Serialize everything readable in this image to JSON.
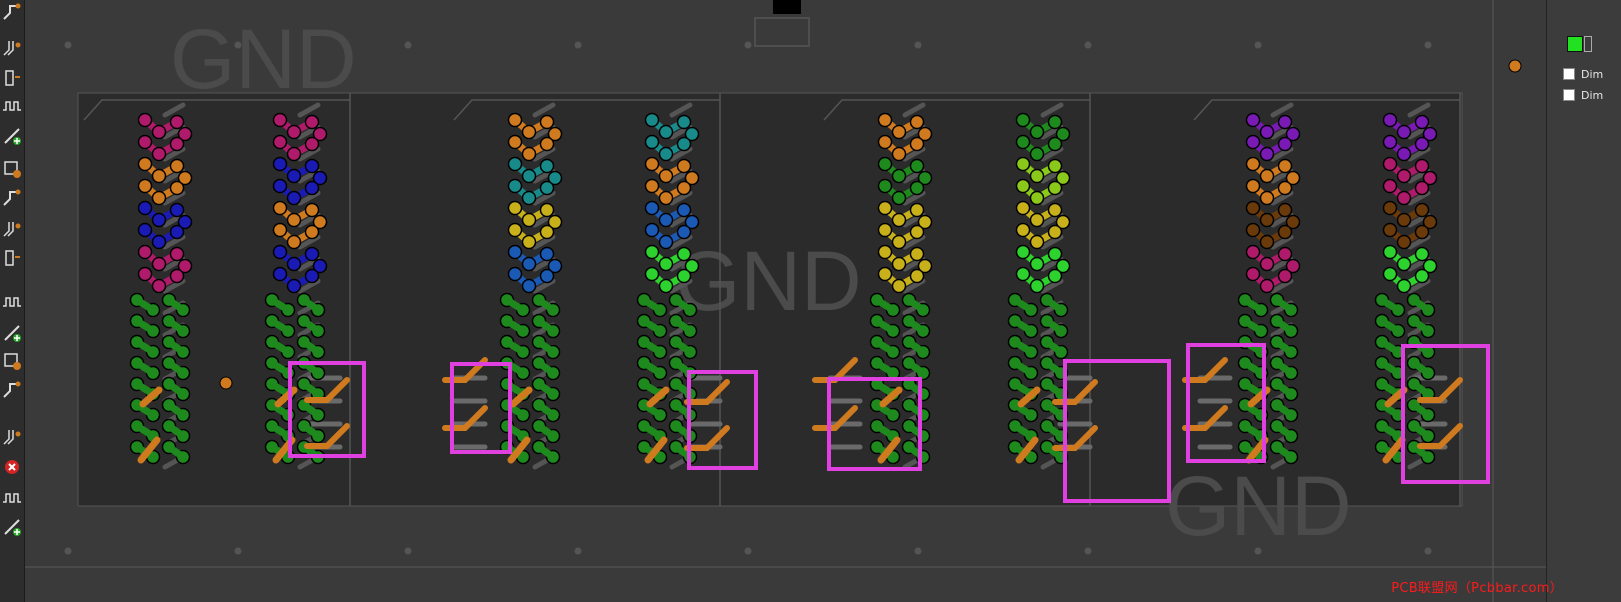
{
  "canvas": {
    "copper_zone_labels": [
      "GND",
      "GND",
      "GND"
    ]
  },
  "right_panel": {
    "layer_color": "#22e022",
    "options": [
      {
        "label": "Dim"
      },
      {
        "label": "Dim"
      }
    ]
  },
  "toolbar": {
    "tools": [
      "route-single-track-icon",
      "route-diff-pair-icon",
      "interactive-drag-icon",
      "tune-length-icon",
      "tune-skew-icon",
      "fanout-icon",
      "multi-track-icon",
      "add-via-icon",
      "add-line-icon",
      "add-zone-icon",
      "add-text-icon",
      "add-textbox-icon",
      "design-rules-icon",
      "add-footprint-icon",
      "delete-icon",
      "measure-icon",
      "inspect-icon"
    ]
  },
  "watermark": {
    "text": "PCB联盟网（Pcbbar.com）"
  },
  "colors": {
    "background": "#3a3a3a",
    "board_fill": "#2b2b2b",
    "orange_track": "#d07a1f",
    "green_net": "#1e8a1e",
    "highlight_box": "#e040e0"
  }
}
